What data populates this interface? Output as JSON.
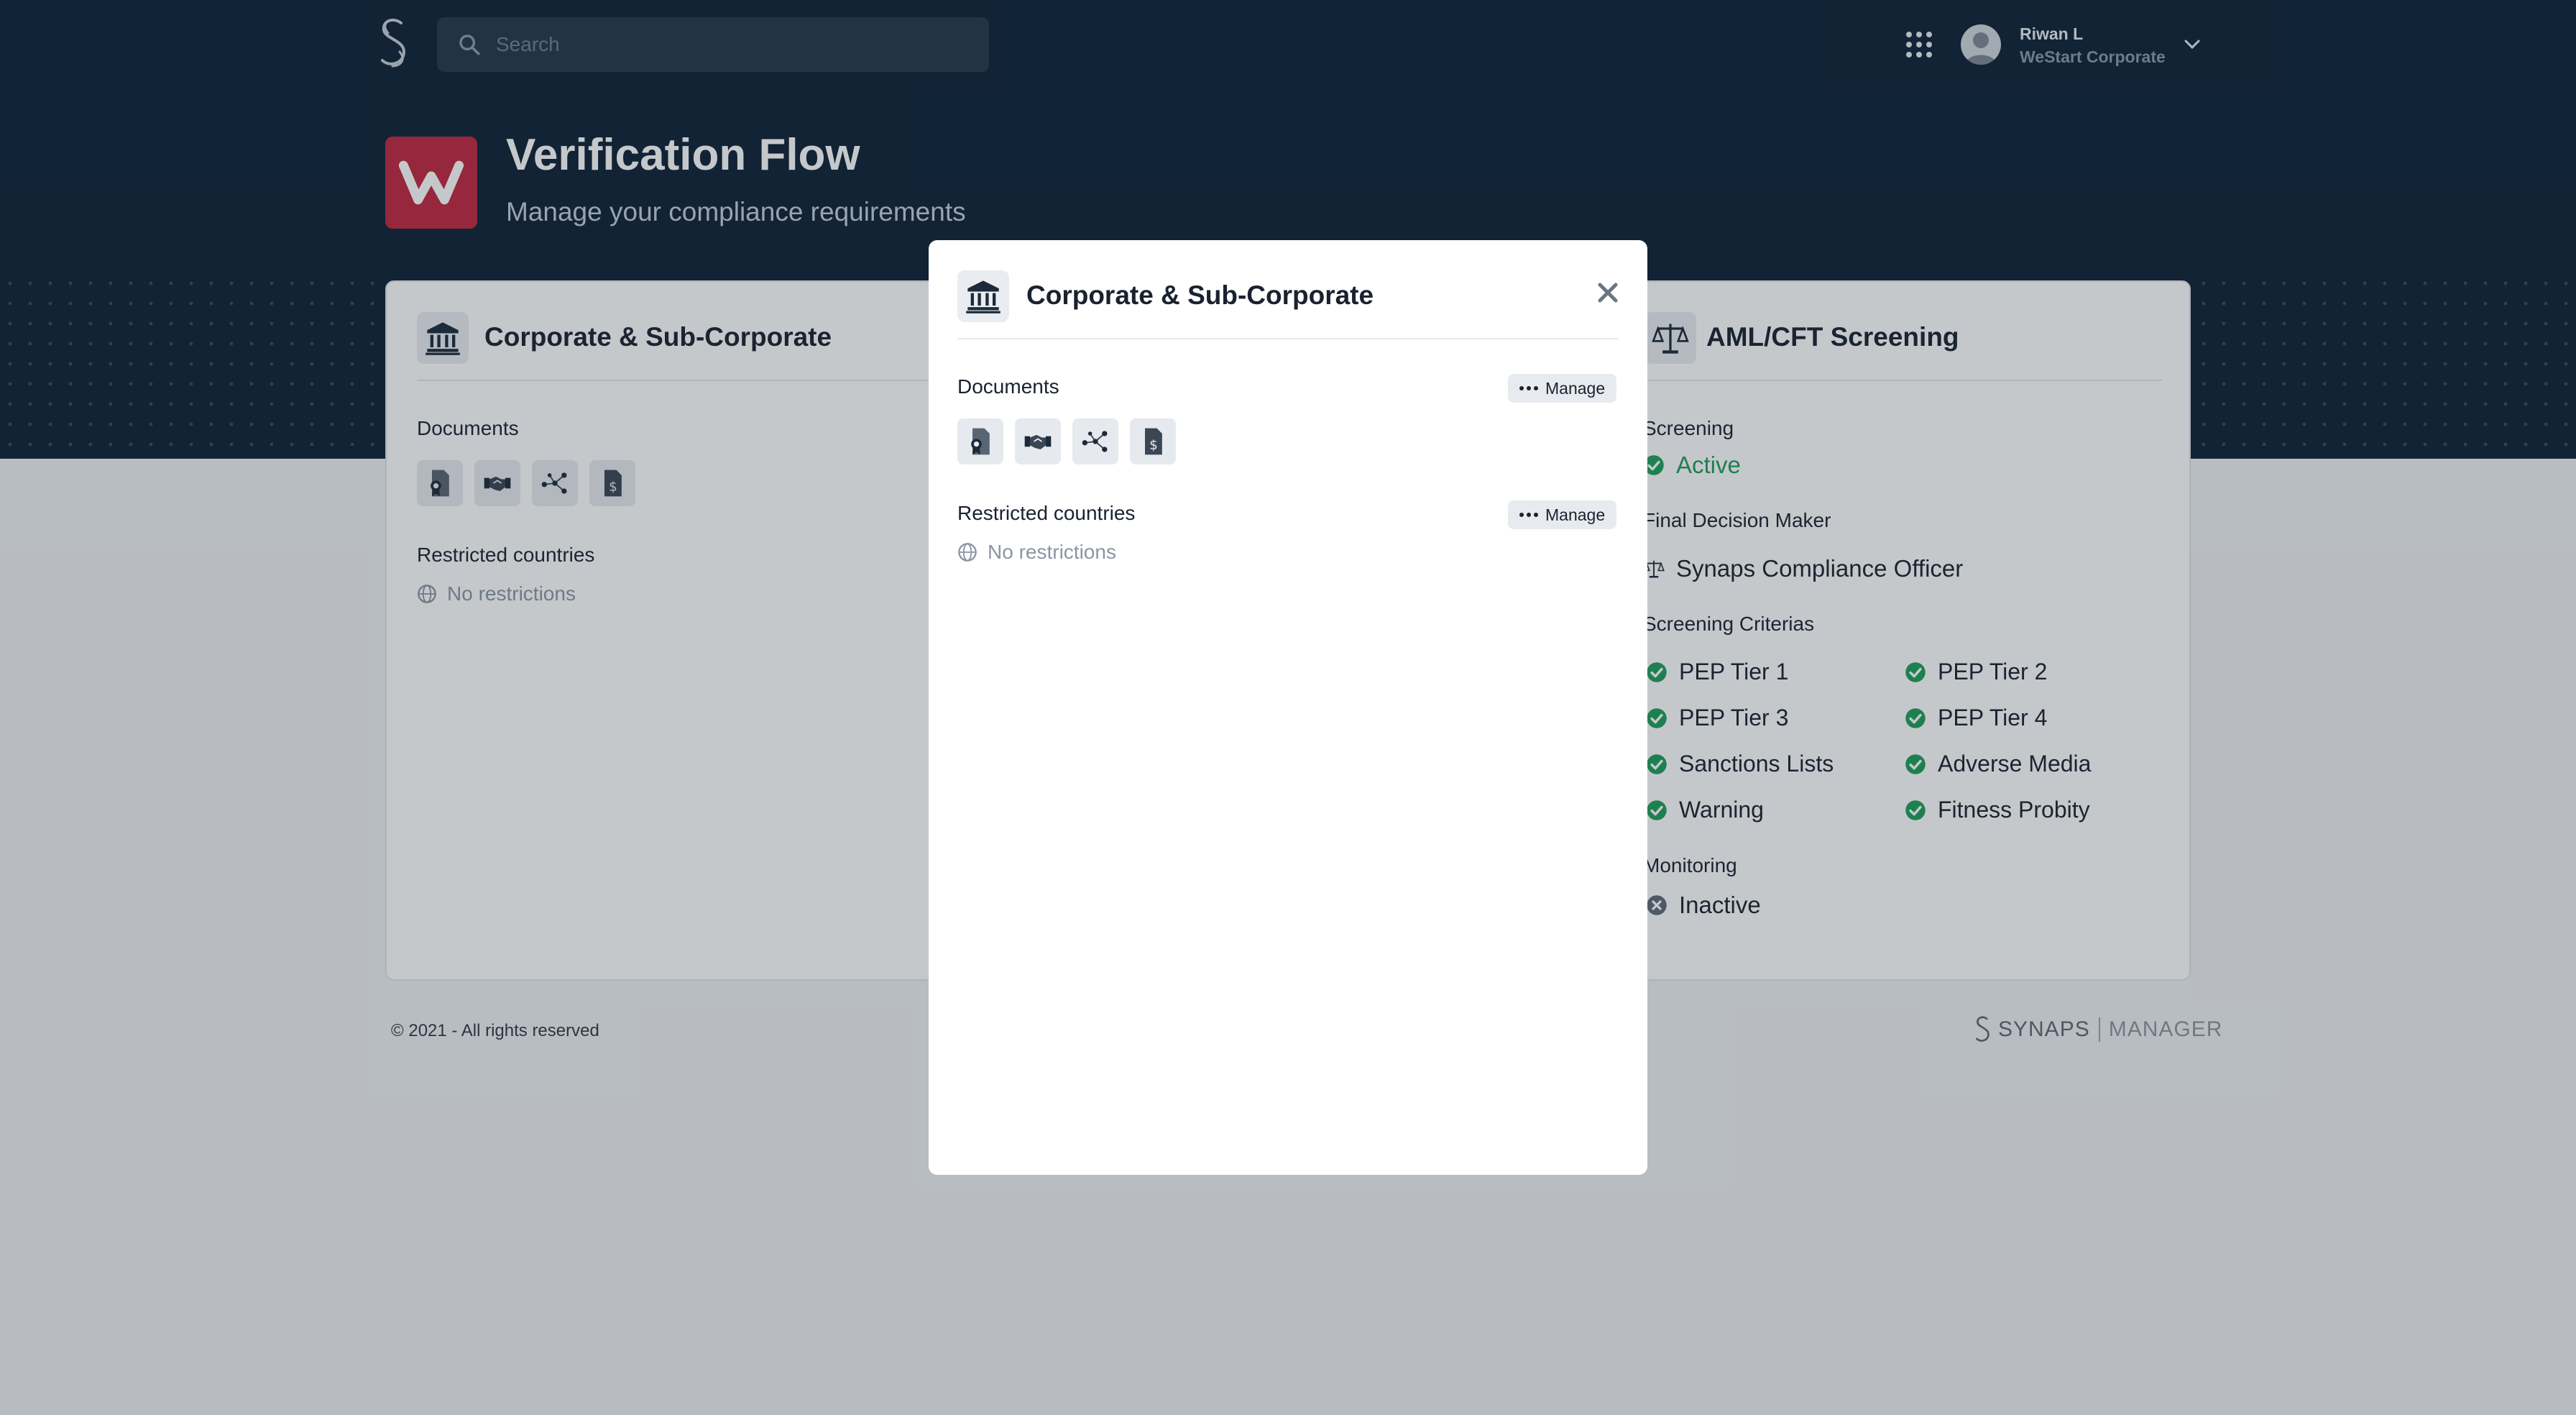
{
  "header": {
    "search_placeholder": "Search",
    "user_name": "Riwan L",
    "user_org": "WeStart Corporate",
    "brand_logo": "synaps-logo-icon",
    "apps_icon": "grid-icon"
  },
  "page": {
    "title": "Verification Flow",
    "subtitle": "Manage your compliance requirements",
    "app_logo_letter": "W",
    "app_logo_color": "#c2273e"
  },
  "corporate_panel": {
    "title": "Corporate & Sub-Corporate",
    "icon": "bank-icon",
    "documents_label": "Documents",
    "documents": [
      "certificate-document-icon",
      "handshake-icon",
      "network-icon",
      "invoice-document-icon"
    ],
    "restricted_label": "Restricted countries",
    "restricted_value": "No restrictions"
  },
  "aml_panel": {
    "title": "AML/CFT Screening",
    "icon": "balance-scale-icon",
    "screening_label": "Screening",
    "screening_status": "Active",
    "final_decision_label": "Final Decision Maker",
    "final_decision_value": "Synaps Compliance Officer",
    "criteria_label": "Screening Criterias",
    "criteria": [
      "PEP Tier 1",
      "PEP Tier 2",
      "PEP Tier 3",
      "PEP Tier 4",
      "Sanctions Lists",
      "Adverse Media",
      "Warning",
      "Fitness Probity"
    ],
    "monitoring_label": "Monitoring",
    "monitoring_status": "Inactive"
  },
  "footer": {
    "copyright": "© 2021 - All rights reserved",
    "brand_name": "SYNAPS",
    "brand_product": "MANAGER"
  },
  "modal": {
    "title": "Corporate & Sub-Corporate",
    "documents_label": "Documents",
    "manage_label": "Manage",
    "restricted_label": "Restricted countries",
    "restricted_value": "No restrictions"
  },
  "colors": {
    "header_bg": "#0d2135",
    "active_green": "#1e9e5a",
    "brand_red": "#c2273e"
  }
}
